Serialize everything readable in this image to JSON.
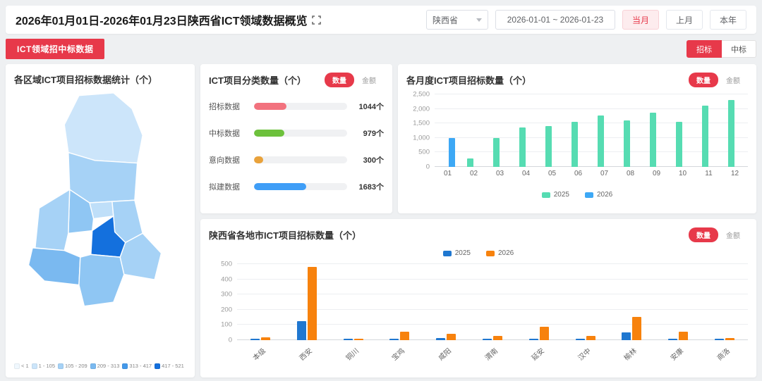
{
  "header": {
    "title": "2026年01月01日-2026年01月23日陕西省ICT领域数据概览",
    "province_select": "陕西省",
    "date_range": "2026-01-01 ~ 2026-01-23",
    "period_buttons": [
      {
        "label": "当月",
        "active": true
      },
      {
        "label": "上月",
        "active": false
      },
      {
        "label": "本年",
        "active": false
      }
    ]
  },
  "section": {
    "tab_label": "ICT领域招中标数据",
    "bid_toggle": [
      {
        "label": "招标",
        "active": true
      },
      {
        "label": "中标",
        "active": false
      }
    ]
  },
  "map_panel": {
    "title": "各区域ICT项目招标数据统计（个）",
    "legend": [
      {
        "label": "< 1",
        "color": "#f0f8fe"
      },
      {
        "label": "1 - 105",
        "color": "#cce5fa"
      },
      {
        "label": "105 - 209",
        "color": "#a6d2f6"
      },
      {
        "label": "209 - 313",
        "color": "#7ab9f0"
      },
      {
        "label": "313 - 417",
        "color": "#4499ea"
      },
      {
        "label": "417 - 521",
        "color": "#1470dd"
      }
    ]
  },
  "category_panel": {
    "title": "ICT项目分类数量（个）",
    "toggle": [
      {
        "label": "数量",
        "active": true
      },
      {
        "label": "金额",
        "active": false
      }
    ],
    "rows": [
      {
        "label": "招标数据",
        "value": 1044,
        "display": "1044个",
        "color": "#f2727e"
      },
      {
        "label": "中标数据",
        "value": 979,
        "display": "979个",
        "color": "#6dc13c"
      },
      {
        "label": "意向数据",
        "value": 300,
        "display": "300个",
        "color": "#e9a23b"
      },
      {
        "label": "拟建数据",
        "value": 1683,
        "display": "1683个",
        "color": "#3f9ef7"
      }
    ]
  },
  "monthly_chart": {
    "type": "bar",
    "title": "各月度ICT项目招标数量（个）",
    "toggle": [
      {
        "label": "数量",
        "active": true
      },
      {
        "label": "金额",
        "active": false
      }
    ],
    "categories": [
      "01",
      "02",
      "03",
      "04",
      "05",
      "06",
      "07",
      "08",
      "09",
      "10",
      "11",
      "12"
    ],
    "series": [
      {
        "name": "2025",
        "color": "#56dcb2",
        "values": [
          0,
          300,
          1000,
          1350,
          1400,
          1550,
          1780,
          1600,
          1870,
          1550,
          2100,
          2300
        ]
      },
      {
        "name": "2026",
        "color": "#3da8f5",
        "values": [
          1000,
          0,
          0,
          0,
          0,
          0,
          0,
          0,
          0,
          0,
          0,
          0
        ]
      }
    ],
    "ylim": [
      0,
      2500
    ],
    "yticks": [
      "0",
      "500",
      "1,000",
      "1,500",
      "2,000",
      "2,500"
    ],
    "legend_position": "bottom"
  },
  "city_chart": {
    "type": "bar",
    "title": "陕西省各地市ICT项目招标数量（个）",
    "toggle": [
      {
        "label": "数量",
        "active": true
      },
      {
        "label": "金额",
        "active": false
      }
    ],
    "categories": [
      "本级",
      "西安",
      "铜川",
      "宝鸡",
      "咸阳",
      "渭南",
      "延安",
      "汉中",
      "榆林",
      "安康",
      "商洛"
    ],
    "series": [
      {
        "name": "2025",
        "color": "#1f77d0",
        "values": [
          8,
          125,
          3,
          10,
          12,
          3,
          10,
          2,
          50,
          5,
          3
        ]
      },
      {
        "name": "2026",
        "color": "#f7820d",
        "values": [
          20,
          480,
          8,
          55,
          42,
          28,
          88,
          28,
          155,
          55,
          15
        ]
      }
    ],
    "ylim": [
      0,
      500
    ],
    "yticks": [
      "0",
      "100",
      "200",
      "300",
      "400",
      "500"
    ],
    "legend_position": "top"
  }
}
